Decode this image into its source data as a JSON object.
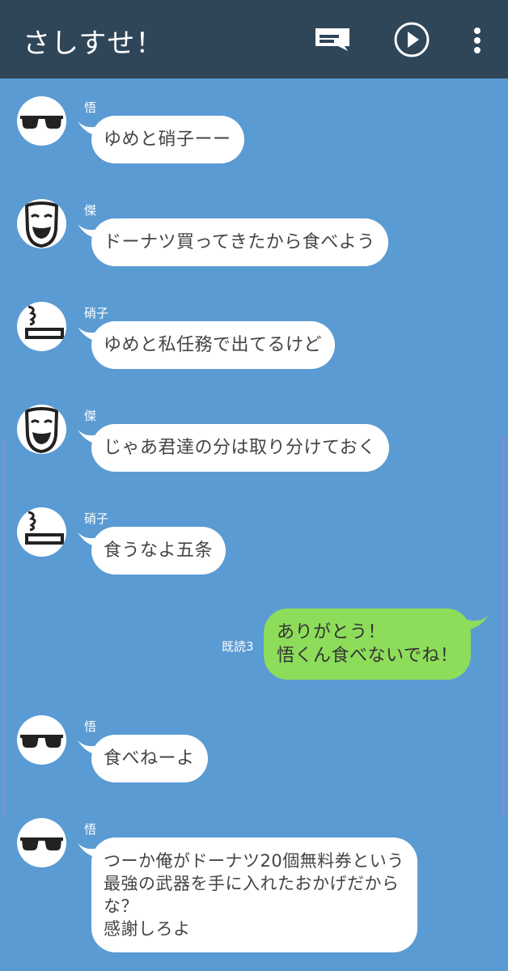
{
  "header": {
    "title": "さしすせ！",
    "icons": [
      "message-icon",
      "play-icon",
      "more-vert-icon"
    ]
  },
  "messages": [
    {
      "sender": "悟",
      "avatar": "sunglasses-avatar",
      "text": "ゆめと硝子ーー"
    },
    {
      "sender": "傑",
      "avatar": "smiling-mask-avatar",
      "text": "ドーナツ買ってきたから食べよう"
    },
    {
      "sender": "硝子",
      "avatar": "smoking-cigarette-avatar",
      "text": "ゆめと私任務で出てるけど"
    },
    {
      "sender": "傑",
      "avatar": "smiling-mask-avatar",
      "text": "じゃあ君達の分は取り分けておく"
    },
    {
      "sender": "硝子",
      "avatar": "smoking-cigarette-avatar",
      "text": "食うなよ五条"
    },
    {
      "sender": "me",
      "read_status": "既読3",
      "text": "ありがとう！\n悟くん食べないでね！"
    },
    {
      "sender": "悟",
      "avatar": "sunglasses-avatar",
      "text": "食べねーよ"
    },
    {
      "sender": "悟",
      "avatar": "sunglasses-avatar",
      "text": "つーか俺がドーナツ20個無料券という\n最強の武器を手に入れたおかげだから\nな？\n感謝しろよ"
    }
  ],
  "colors": {
    "header_bg": "#2f4558",
    "chat_bg": "#5b9bd3",
    "bubble_other": "#ffffff",
    "bubble_me": "#8ddd5b"
  }
}
